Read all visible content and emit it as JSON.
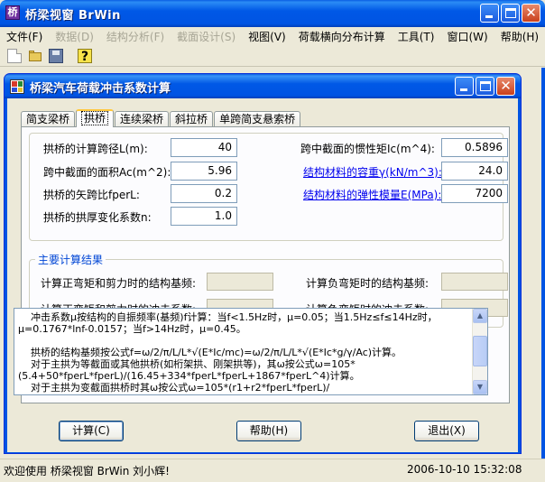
{
  "app": {
    "title": "桥梁视窗 BrWin",
    "icon_letter": "桥"
  },
  "menu": [
    {
      "label": "文件(F)",
      "enabled": true
    },
    {
      "label": "数据(D)",
      "enabled": false
    },
    {
      "label": "结构分析(F)",
      "enabled": false
    },
    {
      "label": "截面设计(S)",
      "enabled": false
    },
    {
      "label": "视图(V)",
      "enabled": true
    },
    {
      "label": "荷载横向分布计算",
      "enabled": true
    },
    {
      "label": "工具(T)",
      "enabled": true
    },
    {
      "label": "窗口(W)",
      "enabled": true
    },
    {
      "label": "帮助(H)",
      "enabled": true
    }
  ],
  "toolbar": {
    "help_glyph": "?"
  },
  "dialog": {
    "title": "桥梁汽车荷载冲击系数计算",
    "tabs": [
      "简支梁桥",
      "拱桥",
      "连续梁桥",
      "斜拉桥",
      "单跨简支悬索桥"
    ],
    "active_tab": 1,
    "inputs_left": [
      {
        "label": "拱桥的计算跨径L(m):",
        "value": "40"
      },
      {
        "label": "跨中截面的面积Ac(m^2):",
        "value": "5.96"
      },
      {
        "label": "拱桥的矢跨比fperL:",
        "value": "0.2"
      },
      {
        "label": "拱桥的拱厚变化系数n:",
        "value": "1.0"
      }
    ],
    "inputs_right": [
      {
        "label": "跨中截面的惯性矩Ic(m^4):",
        "value": "0.5896",
        "link": false
      },
      {
        "label": "结构材料的容重γ(kN/m^3):",
        "value": "24.0",
        "link": true
      },
      {
        "label": "结构材料的弹性模量E(MPa):",
        "value": "7200",
        "link": true
      }
    ],
    "results": {
      "title": "主要计算结果",
      "items": [
        {
          "label": "计算正弯矩和剪力时的结构基频:",
          "value": ""
        },
        {
          "label": "计算负弯矩时的结构基频:",
          "value": ""
        },
        {
          "label": "计算正弯矩和剪力时的冲击系数:",
          "value": ""
        },
        {
          "label": "计算负弯矩时的冲击系数:",
          "value": ""
        }
      ]
    },
    "memo": "    冲击系数μ按结构的自振频率(基频)f计算：当f<1.5Hz时，μ=0.05；当1.5Hz≤f≤14Hz时，μ=0.1767*lnf-0.0157；当f>14Hz时，μ=0.45。\n\n    拱桥的结构基频按公式f=ω/2/π/L/L*√(E*Ic/mc)=ω/2/π/L/L*√(E*Ic*g/γ/Ac)计算。\n    对于主拱为等截面或其他拱桥(如桁架拱、刚架拱等)，其ω按公式ω=105*(5.4+50*fperL*fperL)/(16.45+334*fperL*fperL+1867*fperL^4)计算。\n    对于主拱为变截面拱桥时其ω按公式ω=105*(r1+r2*fperL*fperL)/",
    "buttons": {
      "compute": "计算(C)",
      "help": "帮助(H)",
      "exit": "退出(X)"
    }
  },
  "status": {
    "welcome": "欢迎使用 桥梁视窗 BrWin  刘小辉!",
    "datetime": "2006-10-10 15:32:08"
  },
  "colors": {
    "title_bar": "#0054e3",
    "group_title": "#0046d5",
    "link": "#0000ee"
  }
}
